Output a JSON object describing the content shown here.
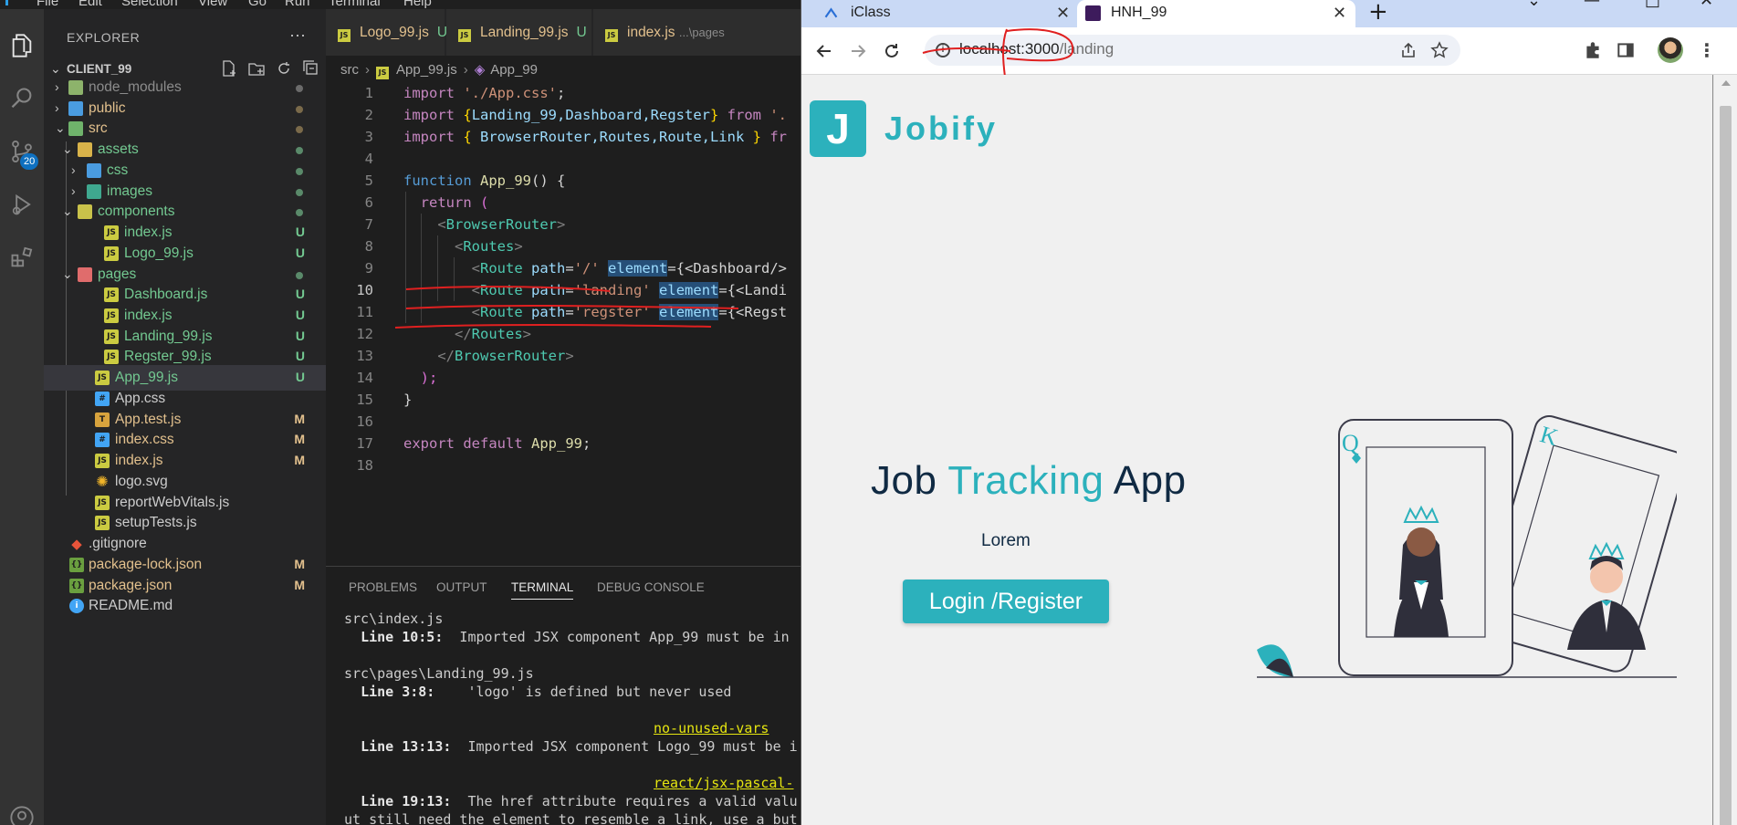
{
  "vscode": {
    "menu": [
      "File",
      "Edit",
      "Selection",
      "View",
      "Go",
      "Run",
      "Terminal",
      "Help"
    ],
    "activity_badge": "20",
    "explorer": {
      "title": "EXPLORER",
      "more": "···",
      "project": "CLIENT_99",
      "rows": [
        {
          "label": "node_modules",
          "status": "",
          "dot": true,
          "dot_color": "#6b6b6b",
          "label_color": "#8c8c8c"
        },
        {
          "label": "public",
          "status": "",
          "dot": true,
          "dot_color": "#6b6b6b"
        },
        {
          "label": "src",
          "status": "",
          "dot": true,
          "dot_color": "#6b6b6b"
        },
        {
          "label": "assets",
          "status": "",
          "dot": true,
          "dot_color": "#73c991"
        },
        {
          "label": "css",
          "status": "",
          "dot": true,
          "dot_color": "#73c991"
        },
        {
          "label": "images",
          "status": "",
          "dot": true,
          "dot_color": "#73c991"
        },
        {
          "label": "components",
          "status": "",
          "dot": true,
          "dot_color": "#73c991"
        },
        {
          "label": "index.js",
          "status": "U"
        },
        {
          "label": "Logo_99.js",
          "status": "U"
        },
        {
          "label": "pages",
          "status": "",
          "dot": true,
          "dot_color": "#73c991"
        },
        {
          "label": "Dashboard.js",
          "status": "U"
        },
        {
          "label": "index.js",
          "status": "U"
        },
        {
          "label": "Landing_99.js",
          "status": "U"
        },
        {
          "label": "Regster_99.js",
          "status": "U"
        },
        {
          "label": "App_99.js",
          "status": "U"
        },
        {
          "label": "App.css",
          "status": ""
        },
        {
          "label": "App.test.js",
          "status": "M"
        },
        {
          "label": "index.css",
          "status": "M"
        },
        {
          "label": "index.js",
          "status": "M"
        },
        {
          "label": "logo.svg",
          "status": ""
        },
        {
          "label": "reportWebVitals.js",
          "status": ""
        },
        {
          "label": "setupTests.js",
          "status": ""
        },
        {
          "label": ".gitignore",
          "status": ""
        },
        {
          "label": "package-lock.json",
          "status": "M"
        },
        {
          "label": "package.json",
          "status": "M"
        },
        {
          "label": "README.md",
          "status": ""
        }
      ]
    },
    "tabs": [
      {
        "name": "Logo_99.js",
        "status": "U",
        "dim": ""
      },
      {
        "name": "Landing_99.js",
        "status": "U",
        "dim": ""
      },
      {
        "name": "index.js",
        "status": "",
        "dim": "...\\pages"
      }
    ],
    "breadcrumb": {
      "root": "src",
      "file": "App_99.js",
      "symbol": "App_99"
    },
    "code_lines": [
      "1",
      "2",
      "3",
      "4",
      "5",
      "6",
      "7",
      "8",
      "9",
      "10",
      "11",
      "12",
      "13",
      "14",
      "15",
      "16",
      "17",
      "18"
    ],
    "code": {
      "l1_import": "import",
      "l1_str": "'./App.css'",
      "l1_end": ";",
      "l2_import": "import",
      "l2_names": "Landing_99,Dashboard,Regster",
      "l2_from": "from",
      "l2_str": "'.",
      "l3_import": "import",
      "l3_names": " BrowserRouter,Routes,Route,Link ",
      "l3_from": "fr",
      "l5_function": "function",
      "l5_name": "App_99",
      "l5_rest": "() {",
      "l6_return": "return",
      "l6_paren": "(",
      "l7_tag": "BrowserRouter",
      "l8_tag": "Routes",
      "l9_tag": "Route",
      "l9_attr": "path",
      "l9_val": "'/'",
      "l9_el": "element",
      "l9_rest": "{<Dashboard/>",
      "l10_tag": "Route",
      "l10_attr": "path",
      "l10_val": "'landing'",
      "l10_el": "element",
      "l10_rest": "{<Landi",
      "l11_tag": "Route",
      "l11_attr": "path",
      "l11_val": "'regster'",
      "l11_el": "element",
      "l11_rest": "{<Regst",
      "l12_tag": "Routes",
      "l13_tag": "BrowserRouter",
      "l14_text": ");",
      "l15_text": "}",
      "l17_export": "export",
      "l17_default": "default",
      "l17_name": "App_99",
      "l17_end": ";"
    },
    "panel_tabs": [
      "PROBLEMS",
      "OUTPUT",
      "TERMINAL",
      "DEBUG CONSOLE"
    ],
    "terminal": {
      "t1": "src\\index.js",
      "t2_loc": "Line 10:5:",
      "t2_msg": "  Imported JSX component App_99 must be in",
      "t3": "src\\pages\\Landing_99.js",
      "t4_loc": "Line 3:8:",
      "t4_msg": "    'logo' is defined but never used",
      "t5": "no-unused-vars",
      "t6_loc": "Line 13:13:",
      "t6_msg": "  Imported JSX component Logo_99 must be i",
      "t7": "react/jsx-pascal-",
      "t8_loc": "Line 19:13:",
      "t8_msg": "  The href attribute requires a valid valu",
      "t9": "ut still need the element to resemble a link, use a but"
    }
  },
  "chrome": {
    "tabs": [
      {
        "title": "iClass",
        "active": false
      },
      {
        "title": "HNH_99",
        "active": true
      }
    ],
    "url_host": "localhost:3000",
    "url_path": "/landing",
    "page": {
      "logo_letter": "J",
      "logo_text": "Jobify",
      "title_a": "Job ",
      "title_accent": "Tracking",
      "title_b": " App",
      "lorem": "Lorem",
      "cta": "Login /Register"
    },
    "colors": {
      "brand": "#2cb1bc",
      "ink": "#102a43"
    }
  }
}
